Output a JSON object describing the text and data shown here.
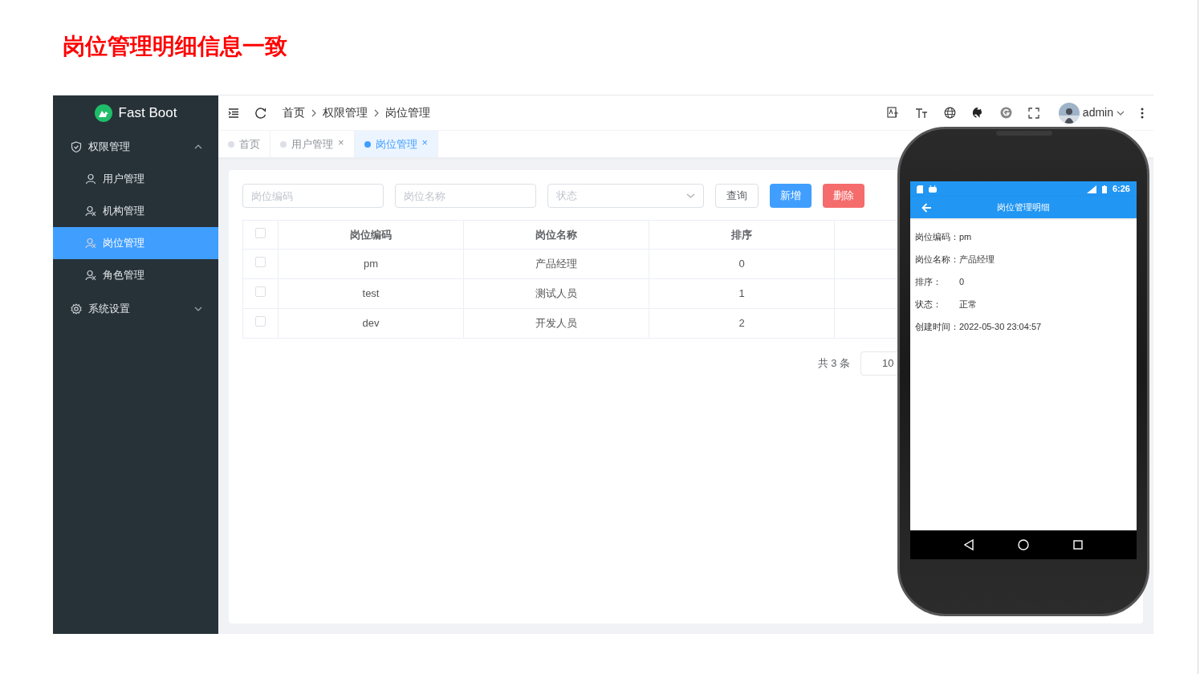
{
  "slide_title": "岗位管理明细信息一致",
  "app": {
    "logo": "Fast Boot",
    "sidebar": {
      "items": [
        {
          "label": "权限管理",
          "expanded": true,
          "children": [
            {
              "label": "用户管理",
              "selected": false
            },
            {
              "label": "机构管理",
              "selected": false
            },
            {
              "label": "岗位管理",
              "selected": true
            },
            {
              "label": "角色管理",
              "selected": false
            }
          ]
        },
        {
          "label": "系统设置",
          "expanded": false
        }
      ]
    },
    "breadcrumbs": [
      "首页",
      "权限管理",
      "岗位管理"
    ],
    "user": "admin",
    "tabs": [
      {
        "label": "首页",
        "selected": false
      },
      {
        "label": "用户管理",
        "selected": false,
        "close": "×"
      },
      {
        "label": "岗位管理",
        "selected": true,
        "close": "×"
      }
    ],
    "filters": [
      {
        "placeholder": "岗位编码",
        "kind": "input"
      },
      {
        "placeholder": "岗位名称",
        "kind": "input"
      },
      {
        "placeholder": "状态",
        "kind": "select"
      }
    ],
    "buttons": [
      {
        "label": "查询",
        "kind": "default"
      },
      {
        "label": "新增",
        "kind": "primary"
      },
      {
        "label": "删除",
        "kind": "danger"
      }
    ],
    "table": {
      "header_checked": false,
      "columns": [
        "岗位编码",
        "岗位名称",
        "排序"
      ],
      "rows": [
        {
          "checked": false,
          "cells": [
            "pm",
            "产品经理",
            "0"
          ]
        },
        {
          "checked": false,
          "cells": [
            "test",
            "测试人员",
            "1"
          ]
        },
        {
          "checked": false,
          "cells": [
            "dev",
            "开发人员",
            "2"
          ]
        }
      ]
    },
    "pagination": {
      "total": "共 3 条",
      "page_size": "10"
    }
  },
  "phone": {
    "time": "6:26",
    "title": "岗位管理明细",
    "fields": [
      {
        "label": "岗位编码：",
        "value": "pm"
      },
      {
        "label": "岗位名称：",
        "value": "产品经理"
      },
      {
        "label": "排序：",
        "value": "0"
      },
      {
        "label": "状态：",
        "value": "正常"
      },
      {
        "label": "创建时间：",
        "value": "2022-05-30 23:04:57"
      }
    ]
  }
}
